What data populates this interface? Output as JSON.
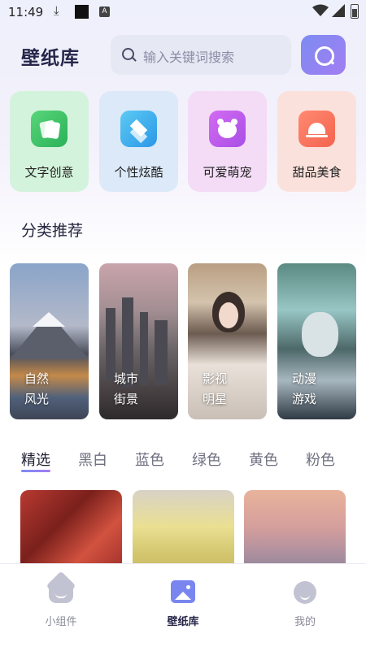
{
  "status_bar": {
    "time": "11:49",
    "badge": "A"
  },
  "header": {
    "logo": "壁纸库",
    "search_placeholder": "输入关键词搜索",
    "accent_gradient": [
      "#7d8cf3",
      "#a27df1"
    ]
  },
  "categories": [
    {
      "label": "文字创意",
      "icon": "cards-icon",
      "color": "#2ab258"
    },
    {
      "label": "个性炫酷",
      "icon": "layers-icon",
      "color": "#2b97e8"
    },
    {
      "label": "可爱萌宠",
      "icon": "pet-face-icon",
      "color": "#a94ee6"
    },
    {
      "label": "甜品美食",
      "icon": "cloche-icon",
      "color": "#f4634f"
    }
  ],
  "section_title": "分类推荐",
  "recommend": [
    {
      "line1": "自然",
      "line2": "风光"
    },
    {
      "line1": "城市",
      "line2": "街景"
    },
    {
      "line1": "影视",
      "line2": "明星"
    },
    {
      "line1": "动漫",
      "line2": "游戏"
    }
  ],
  "color_tabs": [
    "精选",
    "黑白",
    "蓝色",
    "绿色",
    "黄色",
    "粉色"
  ],
  "active_tab": "精选",
  "bottom_nav": [
    {
      "label": "小组件",
      "icon": "home-icon"
    },
    {
      "label": "壁纸库",
      "icon": "gallery-icon",
      "active": true
    },
    {
      "label": "我的",
      "icon": "profile-icon"
    }
  ]
}
